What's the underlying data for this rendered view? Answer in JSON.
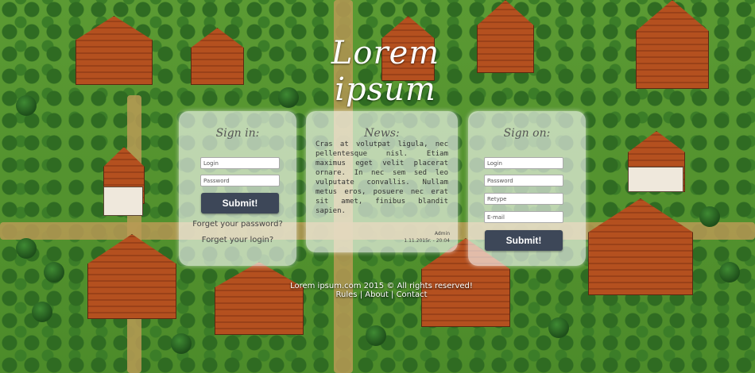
{
  "brand": {
    "logo": "Lorem ipsum"
  },
  "signin": {
    "title": "Sign in:",
    "login_placeholder": "Login",
    "password_placeholder": "Password",
    "submit_label": "Submit!",
    "forgot_password": "Forget your password?",
    "forgot_login": "Forget your login?"
  },
  "news": {
    "title": "News:",
    "body": "Cras at volutpat ligula, nec pellentesque nisl. Etiam maximus eget velit placerat ornare. In nec sem sed leo vulputate convallis. Nullam metus eros, posuere nec erat sit amet, finibus blandit sapien.",
    "author": "Admin",
    "date": "1.11.2015r. - 20:04"
  },
  "signup": {
    "title": "Sign on:",
    "login_placeholder": "Login",
    "password_placeholder": "Password",
    "retype_placeholder": "Retype",
    "email_placeholder": "E-mail",
    "submit_label": "Submit!"
  },
  "footer": {
    "copyright": "Lorem ipsum.com 2015 © All rights reserved!",
    "links": [
      "Rules",
      "About",
      "Contact"
    ],
    "separator": "|"
  }
}
